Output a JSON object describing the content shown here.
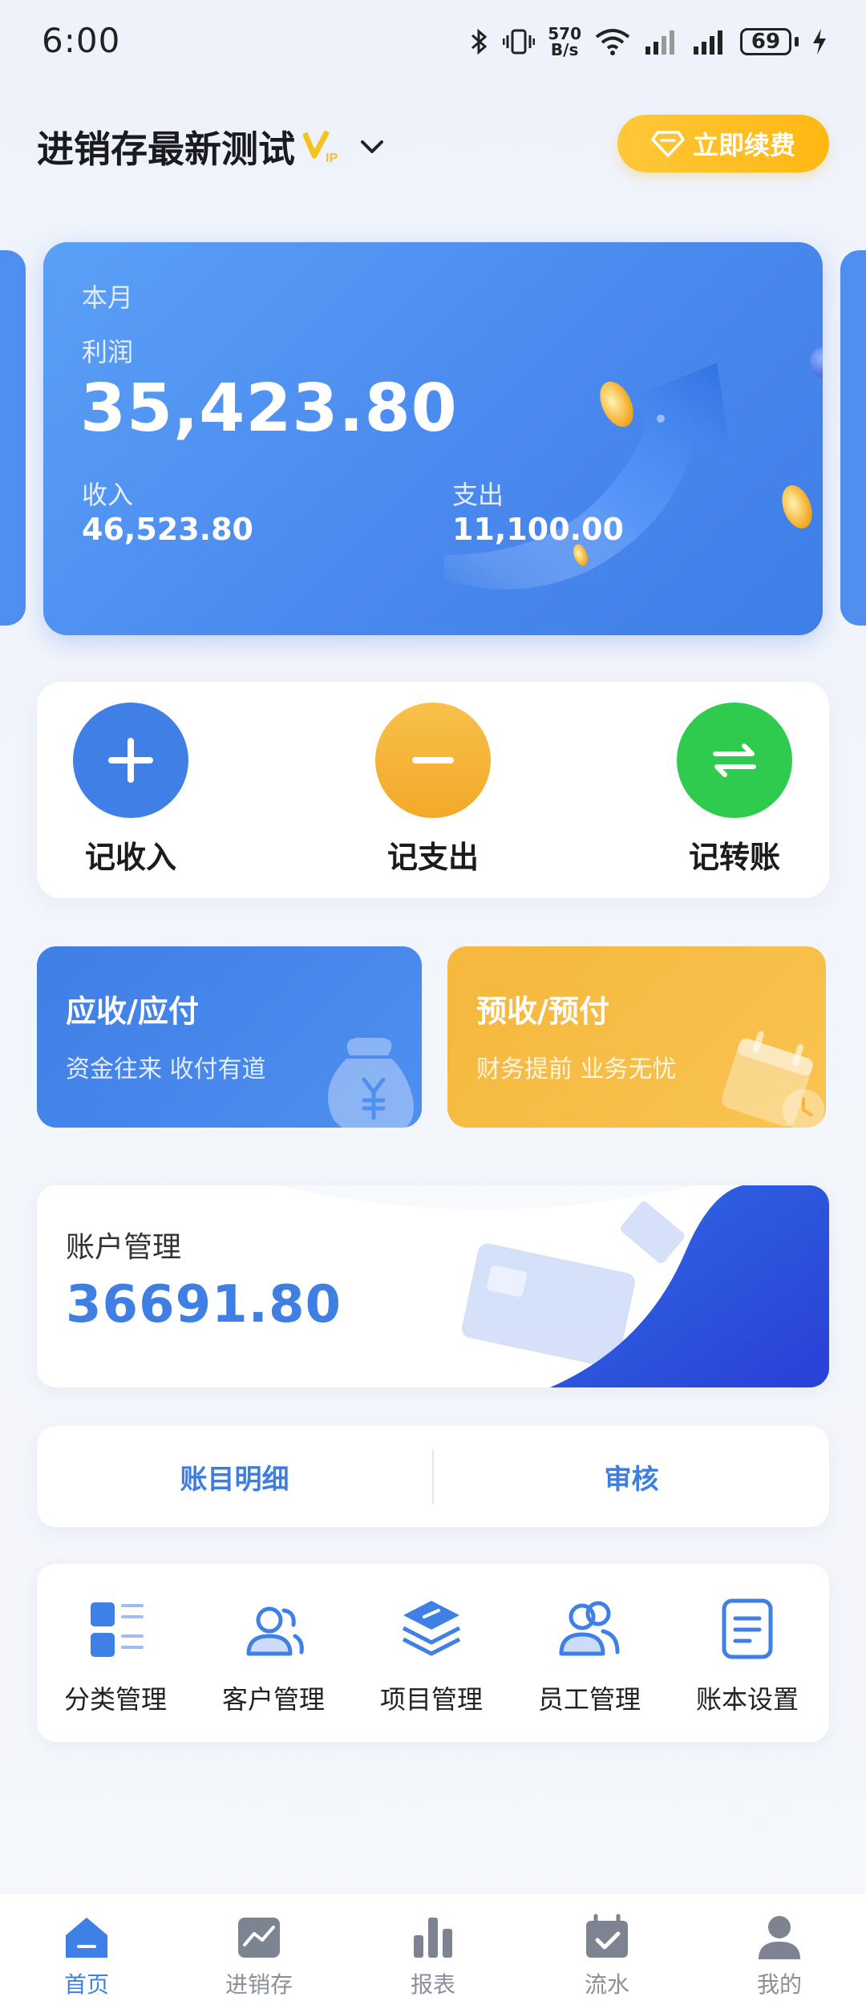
{
  "status_bar": {
    "time": "6:00",
    "net_speed_value": "570",
    "net_speed_unit": "B/s",
    "battery": "69",
    "icons": [
      "bluetooth-icon",
      "vibrate-icon",
      "wifi-icon",
      "signal-icon",
      "battery-icon",
      "charging-icon"
    ]
  },
  "header": {
    "book_name": "进销存最新测试",
    "vip_badge": "VIP",
    "renew_label": "立即续费"
  },
  "profit_card": {
    "period": "本月",
    "profit_label": "利润",
    "profit_value": "35,423.80",
    "income_label": "收入",
    "income_value": "46,523.80",
    "expense_label": "支出",
    "expense_value": "11,100.00"
  },
  "quick_actions": [
    {
      "label": "记收入",
      "icon": "plus-icon",
      "color": "#3f7fe6"
    },
    {
      "label": "记支出",
      "icon": "minus-icon",
      "color": "#f5b53c"
    },
    {
      "label": "记转账",
      "icon": "transfer-icon",
      "color": "#2ecb4f"
    }
  ],
  "promo_cards": [
    {
      "title": "应收/应付",
      "subtitle": "资金往来 收付有道",
      "color": "#3f80e8"
    },
    {
      "title": "预收/预付",
      "subtitle": "财务提前 业务无忧",
      "color": "#f5b13a"
    }
  ],
  "account": {
    "label": "账户管理",
    "value": "36691.80"
  },
  "links": {
    "ledger_detail": "账目明细",
    "audit": "审核"
  },
  "tools": [
    {
      "label": "分类管理",
      "icon": "category-icon"
    },
    {
      "label": "客户管理",
      "icon": "customers-icon"
    },
    {
      "label": "项目管理",
      "icon": "projects-icon"
    },
    {
      "label": "员工管理",
      "icon": "employees-icon"
    },
    {
      "label": "账本设置",
      "icon": "book-settings-icon"
    }
  ],
  "tabs": [
    {
      "label": "首页",
      "icon": "home-icon",
      "active": true
    },
    {
      "label": "进销存",
      "icon": "inventory-icon",
      "active": false
    },
    {
      "label": "报表",
      "icon": "report-icon",
      "active": false
    },
    {
      "label": "流水",
      "icon": "flow-icon",
      "active": false
    },
    {
      "label": "我的",
      "icon": "profile-icon",
      "active": false
    }
  ],
  "colors": {
    "primary": "#3f80e6",
    "accent": "#ffbf2a",
    "success": "#2ecb4f"
  }
}
